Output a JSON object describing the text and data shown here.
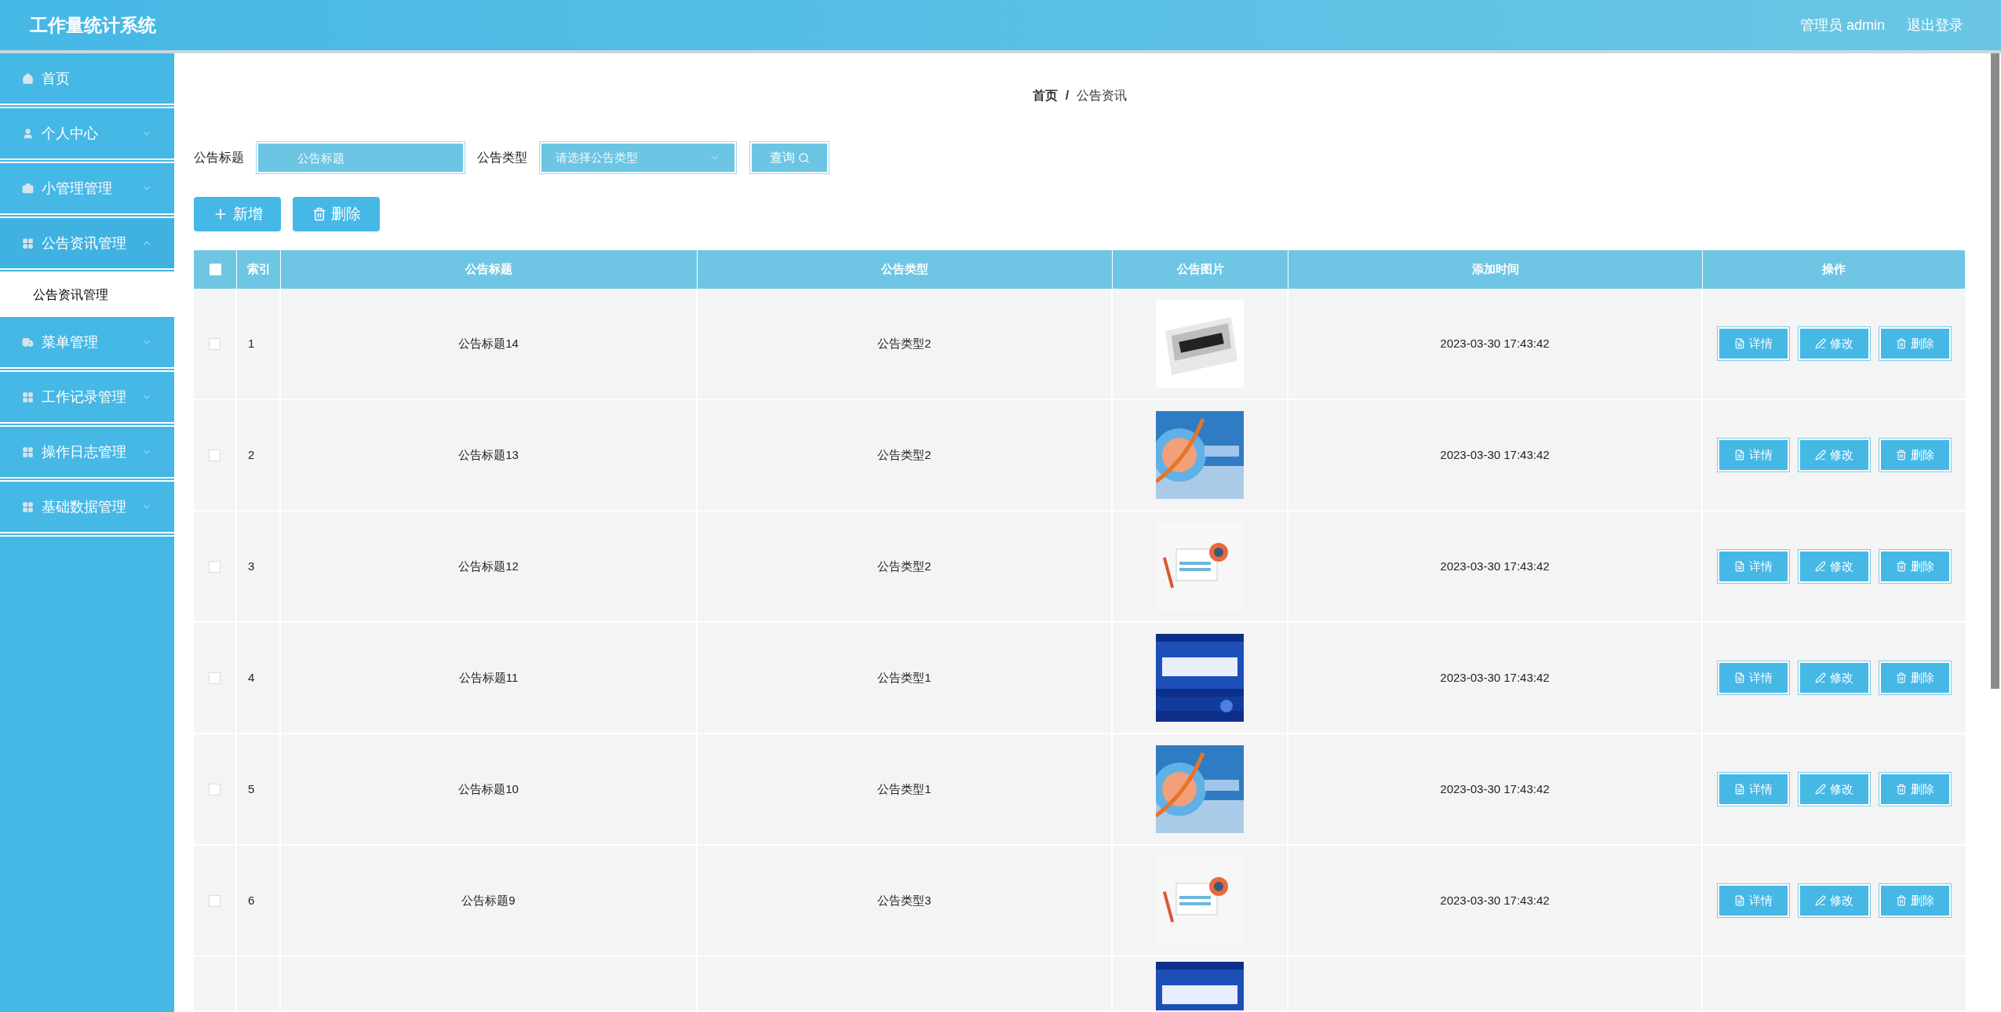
{
  "header": {
    "title": "工作量统计系统",
    "user": "管理员 admin",
    "logout": "退出登录"
  },
  "sidebar": {
    "items": [
      {
        "label": "首页",
        "kind": "link"
      },
      {
        "label": "个人中心",
        "kind": "menu",
        "expanded": false
      },
      {
        "label": "小管理管理",
        "kind": "menu",
        "expanded": false
      },
      {
        "label": "公告资讯管理",
        "kind": "menu",
        "expanded": true,
        "children": [
          {
            "label": "公告资讯管理",
            "selected": true
          }
        ]
      },
      {
        "label": "菜单管理",
        "kind": "menu",
        "expanded": false
      },
      {
        "label": "工作记录管理",
        "kind": "menu",
        "expanded": false
      },
      {
        "label": "操作日志管理",
        "kind": "menu",
        "expanded": false
      },
      {
        "label": "基础数据管理",
        "kind": "menu",
        "expanded": false
      }
    ]
  },
  "breadcrumb": {
    "items": [
      "首页",
      "公告资讯"
    ],
    "separator": "/"
  },
  "search": {
    "fields": [
      {
        "label": "公告标题",
        "kind": "input",
        "placeholder": "公告标题"
      },
      {
        "label": "公告类型",
        "kind": "select",
        "placeholder": "请选择公告类型"
      }
    ],
    "button": "查询"
  },
  "toolbar": [
    {
      "label": "新增",
      "kind": "add"
    },
    {
      "label": "删除",
      "kind": "delete"
    }
  ],
  "table": {
    "select_all": {
      "checked": false
    },
    "columns": [
      "索引",
      "公告标题",
      "公告类型",
      "公告图片",
      "添加时间",
      "操作"
    ],
    "rows": [
      {
        "checked": false,
        "index": "1",
        "title": "公告标题14",
        "type": "公告类型2",
        "image": {
          "kind": "picture"
        },
        "time": "2023-03-30 17:43:42",
        "actions": [
          "详情",
          "修改",
          "删除"
        ]
      },
      {
        "checked": false,
        "index": "2",
        "title": "公告标题13",
        "type": "公告类型2",
        "image": {
          "kind": "picture"
        },
        "time": "2023-03-30 17:43:42",
        "actions": [
          "详情",
          "修改",
          "删除"
        ]
      },
      {
        "checked": false,
        "index": "3",
        "title": "公告标题12",
        "type": "公告类型2",
        "image": {
          "kind": "picture"
        },
        "time": "2023-03-30 17:43:42",
        "actions": [
          "详情",
          "修改",
          "删除"
        ]
      },
      {
        "checked": false,
        "index": "4",
        "title": "公告标题11",
        "type": "公告类型1",
        "image": {
          "kind": "picture"
        },
        "time": "2023-03-30 17:43:42",
        "actions": [
          "详情",
          "修改",
          "删除"
        ]
      },
      {
        "checked": false,
        "index": "5",
        "title": "公告标题10",
        "type": "公告类型1",
        "image": {
          "kind": "picture"
        },
        "time": "2023-03-30 17:43:42",
        "actions": [
          "详情",
          "修改",
          "删除"
        ]
      },
      {
        "checked": false,
        "index": "6",
        "title": "公告标题9",
        "type": "公告类型3",
        "image": {
          "kind": "picture"
        },
        "time": "2023-03-30 17:43:42",
        "actions": [
          "详情",
          "修改",
          "删除"
        ]
      },
      {
        "image": {
          "kind": "picture"
        }
      }
    ]
  }
}
